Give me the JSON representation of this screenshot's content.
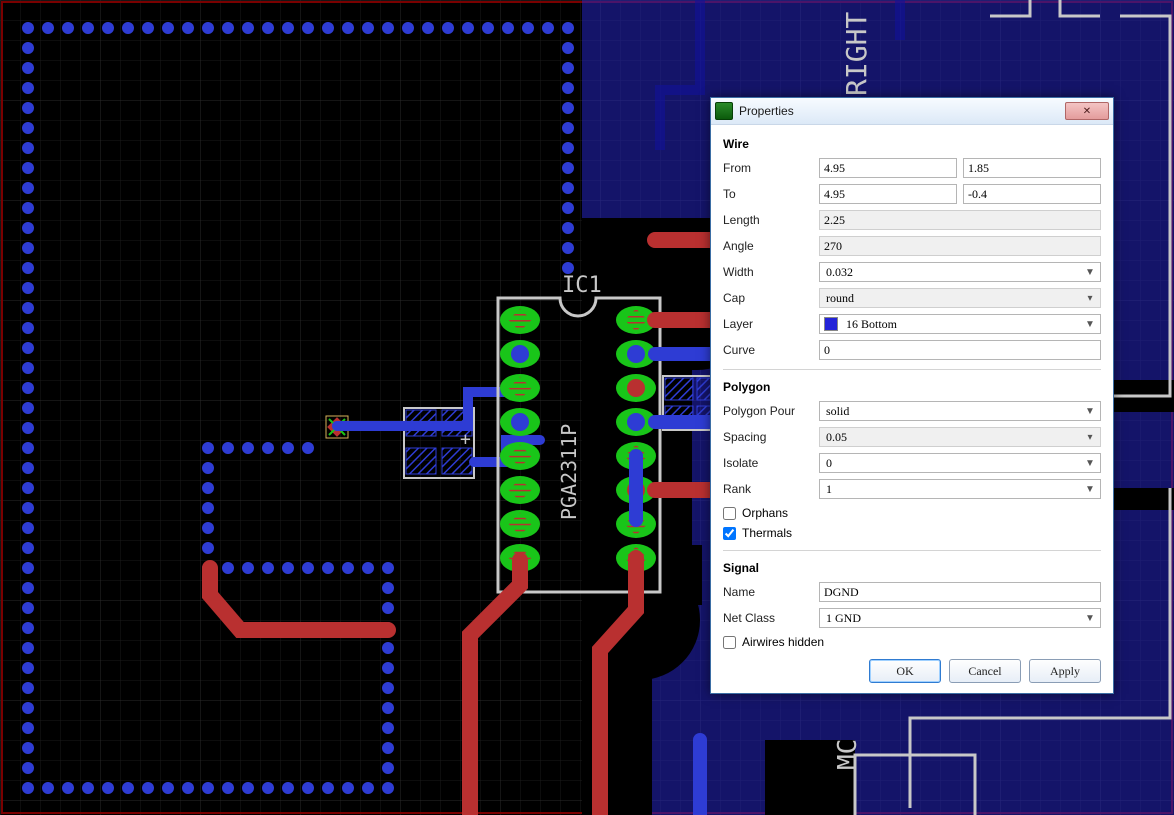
{
  "dialog": {
    "title": "Properties",
    "close_glyph": "✕",
    "sections": {
      "wire": {
        "heading": "Wire",
        "from_label": "From",
        "from_x": "4.95",
        "from_y": "1.85",
        "to_label": "To",
        "to_x": "4.95",
        "to_y": "-0.4",
        "length_label": "Length",
        "length": "2.25",
        "angle_label": "Angle",
        "angle": "270",
        "width_label": "Width",
        "width": "0.032",
        "cap_label": "Cap",
        "cap": "round",
        "layer_label": "Layer",
        "layer": "16 Bottom",
        "curve_label": "Curve",
        "curve": "0"
      },
      "polygon": {
        "heading": "Polygon",
        "pour_label": "Polygon Pour",
        "pour": "solid",
        "spacing_label": "Spacing",
        "spacing": "0.05",
        "isolate_label": "Isolate",
        "isolate": "0",
        "rank_label": "Rank",
        "rank": "1",
        "orphans_label": "Orphans",
        "orphans_checked": false,
        "thermals_label": "Thermals",
        "thermals_checked": true
      },
      "signal": {
        "heading": "Signal",
        "name_label": "Name",
        "name": "DGND",
        "netclass_label": "Net Class",
        "netclass": "1 GND",
        "airwires_label": "Airwires hidden",
        "airwires_checked": false
      }
    },
    "buttons": {
      "ok": "OK",
      "cancel": "Cancel",
      "apply": "Apply"
    }
  },
  "pcb": {
    "layer_colors": {
      "top": "#b93030",
      "bottom": "#2e3cd4",
      "pad": "#19c519",
      "silk": "#c8c8c8",
      "outline": "#d9d9d9",
      "origin": "#ff0000",
      "dim_blue": "#3a3ab8"
    },
    "ic_ref": "IC1",
    "ic_value": "PGA2311P",
    "conn_right_top": "RIGHT",
    "conn_right_bottom": "MC"
  }
}
